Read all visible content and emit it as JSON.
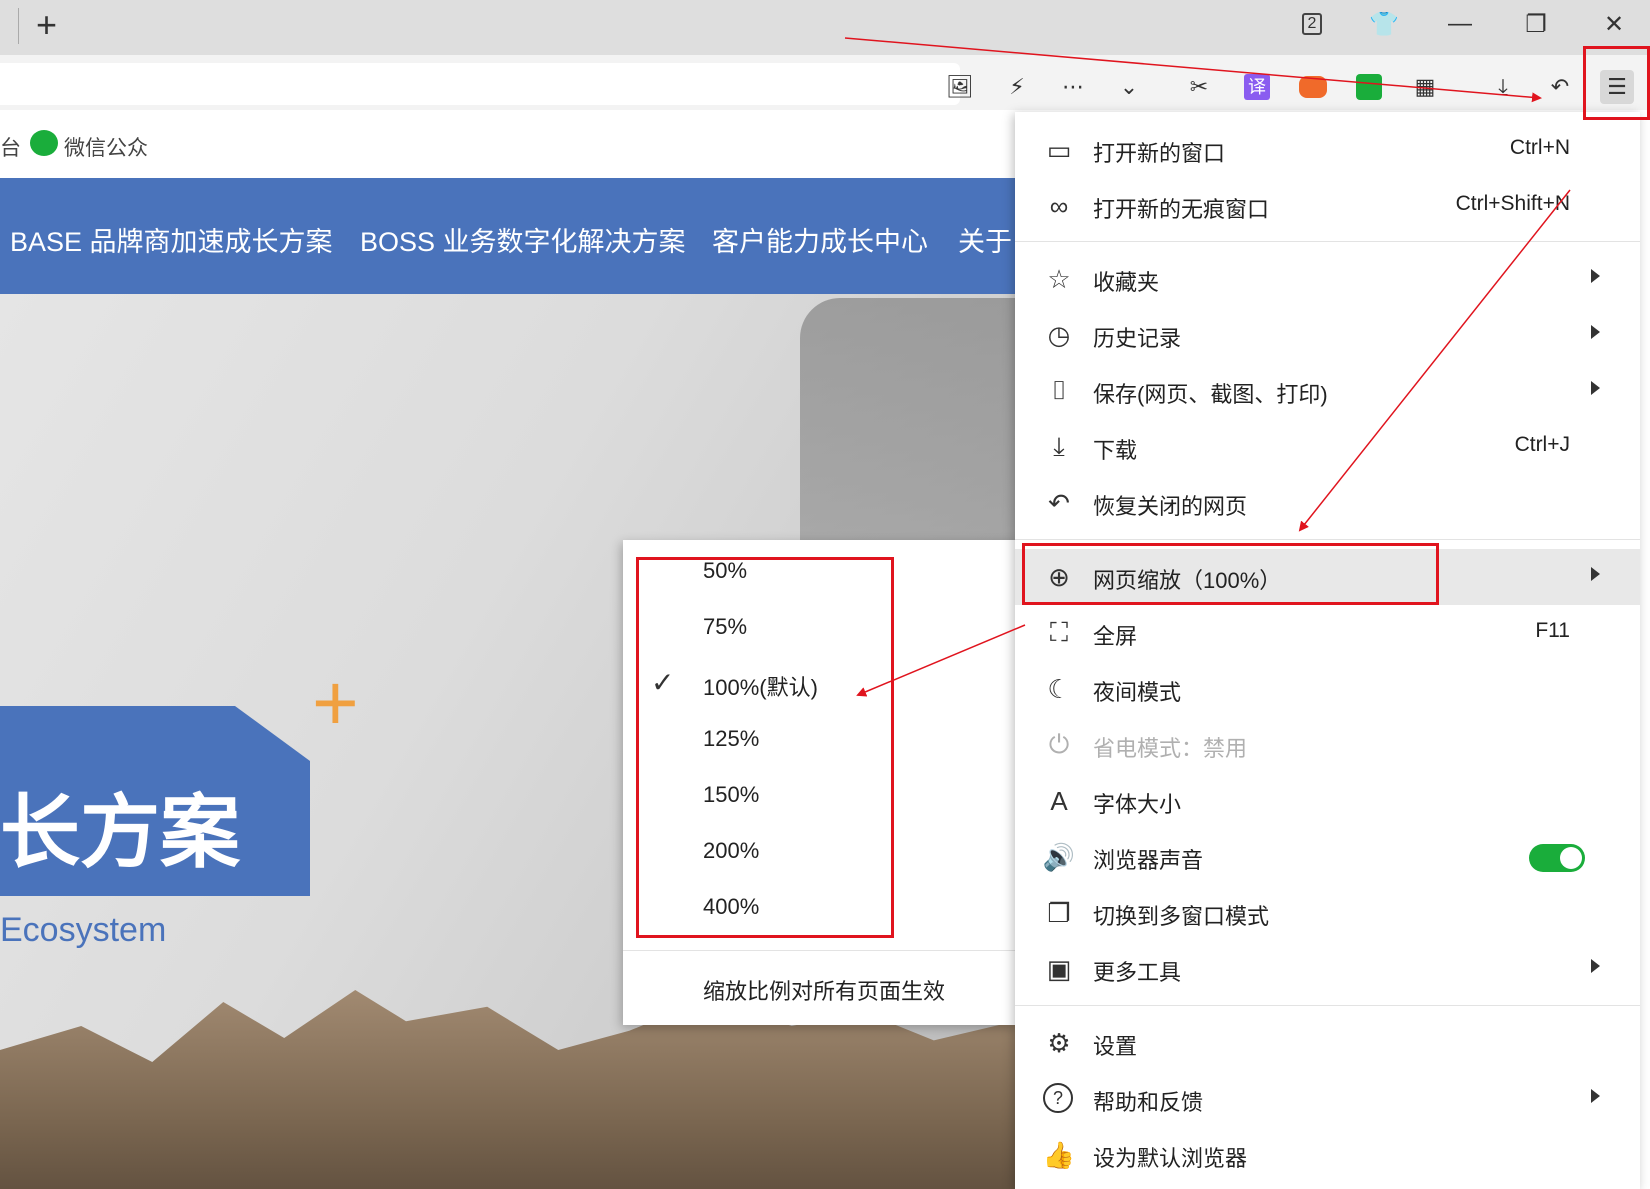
{
  "tabbar": {
    "new_tab_label": "+",
    "tab_count": "2"
  },
  "bookmarks": {
    "partial_left": "台",
    "wechat_label": "微信公众"
  },
  "site": {
    "nav": [
      "BASE 品牌商加速成长方案",
      "BOSS 业务数字化解决方案",
      "客户能力成长中心",
      "关于"
    ],
    "hero_title": "长方案",
    "hero_sub": "Ecosystem"
  },
  "toolbar_icons": [
    "image-icon",
    "lightning-icon",
    "more-icon",
    "chevron-down-icon",
    "scissors-icon",
    "translate-icon",
    "game-icon",
    "wallet-icon",
    "apps-icon",
    "download-icon",
    "undo-icon",
    "menu-icon"
  ],
  "translate_glyph": "译",
  "menu": {
    "items": [
      {
        "icon": "window-icon",
        "glyph": "▭",
        "label": "打开新的窗口",
        "shortcut": "Ctrl+N"
      },
      {
        "icon": "incognito-icon",
        "glyph": "∞",
        "label": "打开新的无痕窗口",
        "shortcut": "Ctrl+Shift+N"
      },
      {
        "icon": "favorites-icon",
        "glyph": "☆",
        "label": "收藏夹",
        "submenu": true
      },
      {
        "icon": "history-icon",
        "glyph": "◷",
        "label": "历史记录",
        "submenu": true
      },
      {
        "icon": "camera-icon",
        "glyph": "⌷",
        "label": "保存(网页、截图、打印)",
        "submenu": true
      },
      {
        "icon": "download-icon",
        "glyph": "⤓",
        "label": "下载",
        "shortcut": "Ctrl+J"
      },
      {
        "icon": "restore-icon",
        "glyph": "↶",
        "label": "恢复关闭的网页"
      },
      {
        "icon": "zoom-icon",
        "glyph": "⊕",
        "label": "网页缩放（100%）",
        "submenu": true
      },
      {
        "icon": "fullscreen-icon",
        "glyph": "⛶",
        "label": "全屏",
        "shortcut": "F11"
      },
      {
        "icon": "night-mode-icon",
        "glyph": "☾",
        "label": "夜间模式"
      },
      {
        "icon": "power-save-icon",
        "glyph": "⏻",
        "label": "省电模式：禁用",
        "disabled": true
      },
      {
        "icon": "font-size-icon",
        "glyph": "A",
        "label": "字体大小"
      },
      {
        "icon": "sound-icon",
        "glyph": "🔊",
        "label": "浏览器声音",
        "toggle": true
      },
      {
        "icon": "multi-window-icon",
        "glyph": "❐",
        "label": "切换到多窗口模式"
      },
      {
        "icon": "toolbox-icon",
        "glyph": "▣",
        "label": "更多工具",
        "submenu": true
      },
      {
        "icon": "settings-icon",
        "glyph": "⚙",
        "label": "设置"
      },
      {
        "icon": "help-icon",
        "glyph": "?",
        "label": "帮助和反馈",
        "submenu": true
      },
      {
        "icon": "thumbs-up-icon",
        "glyph": "👍",
        "label": "设为默认浏览器"
      }
    ]
  },
  "zoom_submenu": {
    "options": [
      "50%",
      "75%",
      "100%(默认)",
      "125%",
      "150%",
      "200%",
      "400%"
    ],
    "checked_index": 2,
    "apply_all_label": "缩放比例对所有页面生效"
  },
  "colors": {
    "accent_blue": "#4a73bb",
    "annotation_red": "#e0141e",
    "toggle_green": "#1aad3b"
  }
}
